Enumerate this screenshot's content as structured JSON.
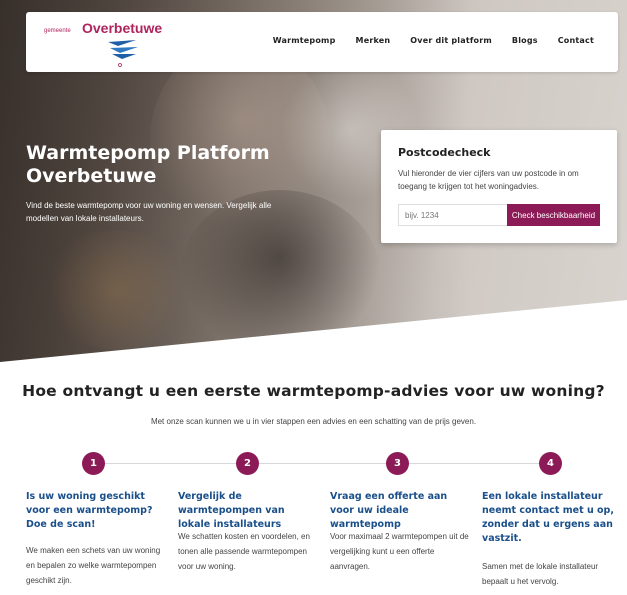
{
  "logo": {
    "prefix": "gemeente",
    "name": "Overbetuwe"
  },
  "nav": {
    "items": [
      "Warmtepomp",
      "Merken",
      "Over dit platform",
      "Blogs",
      "Contact"
    ]
  },
  "hero": {
    "title": "Warmtepomp Platform Overbetuwe",
    "subtitle": "Vind de beste warmtepomp voor uw woning en wensen. Vergelijk alle modellen van lokale installateurs."
  },
  "postcode": {
    "title": "Postcodecheck",
    "text": "Vul hieronder de vier cijfers van uw postcode in om toegang te krijgen tot het woningadvies.",
    "placeholder": "bijv. 1234",
    "button": "Check beschikbaarheid"
  },
  "main": {
    "heading": "Hoe ontvangt u een eerste warmtepomp-advies voor uw woning?",
    "intro": "Met onze scan kunnen we u in vier stappen een advies en een schatting van de prijs geven.",
    "steps": [
      {
        "number": "1",
        "title": "Is uw woning geschikt voor een warmtepomp? Doe de scan!",
        "text": "We maken een schets van uw woning en bepalen zo welke warmtepompen geschikt zijn."
      },
      {
        "number": "2",
        "title": "Vergelijk de warmtepompen van lokale installateurs",
        "text": "We schatten kosten en voordelen, en tonen alle passende warmtepompen voor uw woning."
      },
      {
        "number": "3",
        "title": "Vraag een offerte aan voor uw ideale warmtepomp",
        "text": "Voor maximaal 2 warmtepompen uit de vergelijking kunt u een offerte aanvragen."
      },
      {
        "number": "4",
        "title": "Een lokale installateur neemt contact met u op, zonder dat u ergens aan vastzit.",
        "text": "Samen met de lokale installateur bepaalt u het vervolg."
      }
    ]
  },
  "colors": {
    "accent": "#8c1a56",
    "brand": "#b0245e",
    "step_title": "#1a4f8a"
  }
}
